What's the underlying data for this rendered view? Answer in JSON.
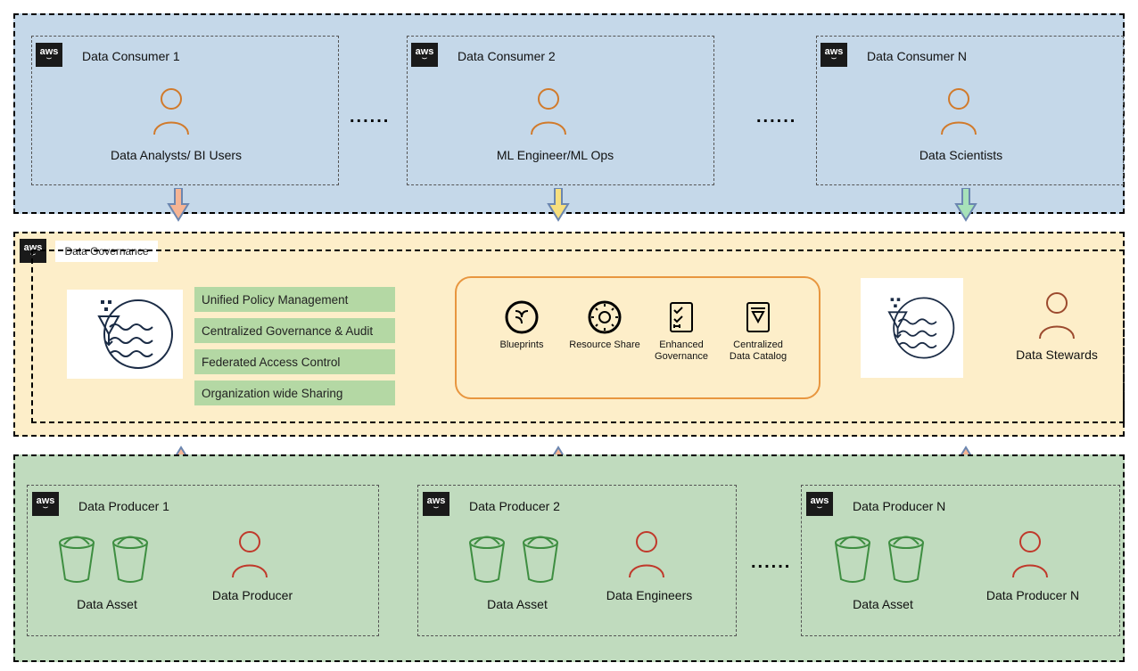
{
  "consumers": {
    "items": [
      {
        "title": "Data Consumer 1",
        "role": "Data Analysts/ BI Users"
      },
      {
        "title": "Data Consumer 2",
        "role": "ML Engineer/ML Ops"
      },
      {
        "title": "Data Consumer N",
        "role": "Data Scientists"
      }
    ]
  },
  "governance": {
    "label": "Data Governance",
    "features": [
      "Unified Policy Management",
      "Centralized  Governance & Audit",
      "Federated Access Control",
      "Organization wide Sharing"
    ],
    "capabilities": [
      "Blueprints",
      "Resource Share",
      "Enhanced Governance",
      "Centralized Data Catalog"
    ],
    "steward_role": "Data Stewards"
  },
  "producers": {
    "items": [
      {
        "title": "Data Producer 1",
        "asset_label": "Data Asset",
        "role": "Data Producer"
      },
      {
        "title": "Data Producer 2",
        "asset_label": "Data Asset",
        "role": "Data Engineers"
      },
      {
        "title": "Data Producer N",
        "asset_label": "Data Asset",
        "role": "Data Producer N"
      }
    ]
  },
  "colors": {
    "consumer_bg": "#c5d8e9",
    "governance_bg": "#fdeec9",
    "producer_bg": "#c0dbbe",
    "pill": "#b4d8a4",
    "capsule_border": "#e8963f",
    "user_orange": "#d17a2b",
    "user_red": "#c0392b",
    "bucket_green": "#3e8e41"
  }
}
